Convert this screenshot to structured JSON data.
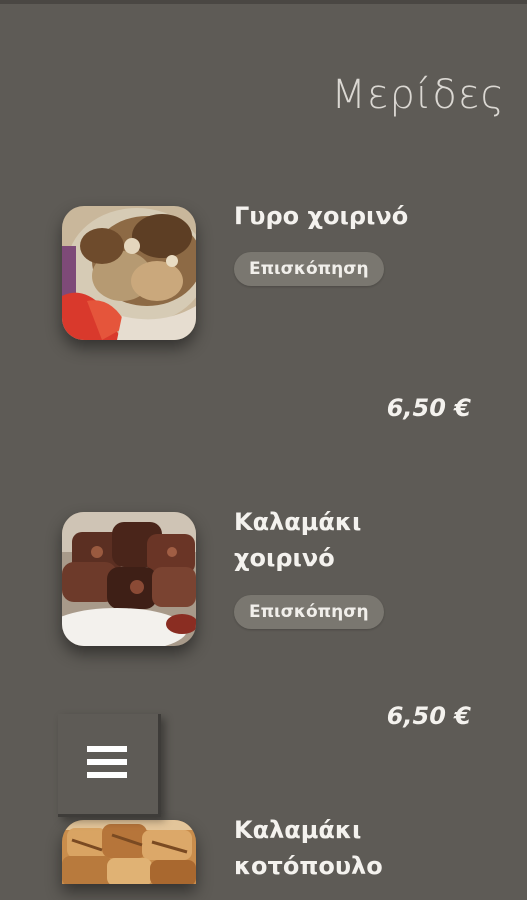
{
  "header": {
    "title": "Μερίδες"
  },
  "items": [
    {
      "name": "Γυρο χοιρινό",
      "overview_label": "Επισκόπηση",
      "price": "6,50 €",
      "icon": "gyro-pork-photo"
    },
    {
      "name_line1": "Καλαμάκι",
      "name_line2": "χοιρινό",
      "overview_label": "Επισκόπηση",
      "price": "6,50 €",
      "icon": "skewer-pork-photo"
    },
    {
      "name_line1": "Καλαμάκι",
      "name_line2": "κοτόπουλο",
      "icon": "skewer-chicken-photo"
    }
  ],
  "menu_button": {
    "icon": "hamburger-menu-icon"
  },
  "colors": {
    "background": "#5e5b56",
    "button_bg": "#7a7770",
    "text": "#f4f2ee"
  }
}
